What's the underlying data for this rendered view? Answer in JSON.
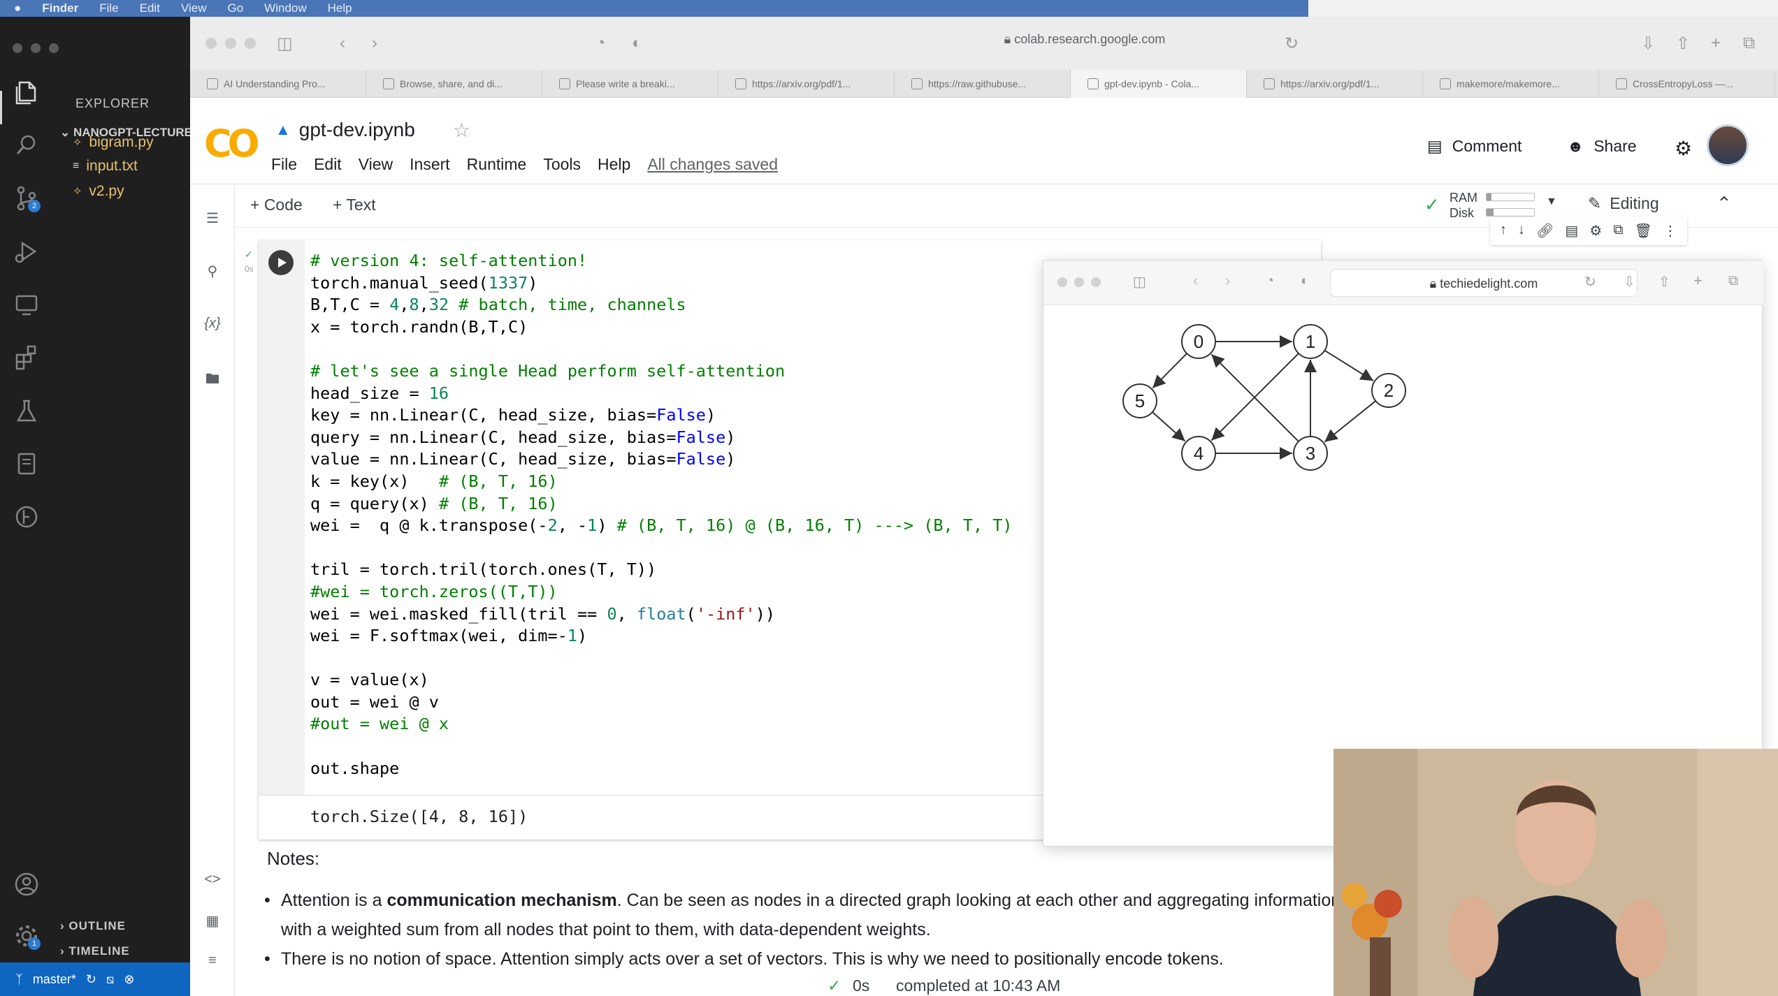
{
  "menubar": {
    "app": "Finder",
    "items": [
      "File",
      "Edit",
      "View",
      "Go",
      "Window",
      "Help"
    ]
  },
  "vscode": {
    "explorer_title": "EXPLORER",
    "folder": "NANOGPT-LECTURE",
    "files": [
      {
        "name": "bigram.py",
        "icon": "python-icon"
      },
      {
        "name": "input.txt",
        "icon": "text-file-icon"
      },
      {
        "name": "v2.py",
        "icon": "python-icon"
      }
    ],
    "outline": "OUTLINE",
    "timeline": "TIMELINE",
    "branch": "master*",
    "scm_badge": "2",
    "settings_badge": "1"
  },
  "browser": {
    "url": "colab.research.google.com",
    "tabs": [
      "AI Understanding Pro...",
      "Browse, share, and di...",
      "Please write a breaki...",
      "https://arxiv.org/pdf/1...",
      "https://raw.githubuse...",
      "gpt-dev.ipynb - Cola...",
      "https://arxiv.org/pdf/1...",
      "makemore/makemore...",
      "CrossEntropyLoss —..."
    ],
    "active_tab_index": 5
  },
  "colab": {
    "logo": "CO",
    "notebook_title": "gpt-dev.ipynb",
    "menus": [
      "File",
      "Edit",
      "View",
      "Insert",
      "Runtime",
      "Tools",
      "Help"
    ],
    "save_status": "All changes saved",
    "comment": "Comment",
    "share": "Share",
    "add_code": "+ Code",
    "add_text": "+ Text",
    "ram_label": "RAM",
    "disk_label": "Disk",
    "ram_fraction": 0.1,
    "disk_fraction": 0.15,
    "editing": "Editing",
    "exec_time": "0s",
    "output": "torch.Size([4, 8, 16])",
    "footer_time": "0s",
    "footer_status": "completed at 10:43 AM"
  },
  "notes": {
    "title": "Notes:",
    "bullet1_pre": "Attention is a ",
    "bullet1_bold": "communication mechanism",
    "bullet1_post": ". Can be seen as nodes in a directed graph looking at each other and aggregating information",
    "bullet1_line2": "with a weighted sum from all nodes that point to them, with data-dependent weights.",
    "bullet2": "There is no notion of space. Attention simply acts over a set of vectors. This is why we need to positionally encode tokens."
  },
  "overlay": {
    "url": "techiedelight.com",
    "graph": {
      "nodes": [
        "0",
        "1",
        "2",
        "3",
        "4",
        "5"
      ],
      "edges": [
        [
          "0",
          "1"
        ],
        [
          "1",
          "2"
        ],
        [
          "2",
          "3"
        ],
        [
          "3",
          "1"
        ],
        [
          "3",
          "0"
        ],
        [
          "1",
          "4"
        ],
        [
          "0",
          "5"
        ],
        [
          "5",
          "4"
        ],
        [
          "4",
          "3"
        ]
      ]
    }
  }
}
